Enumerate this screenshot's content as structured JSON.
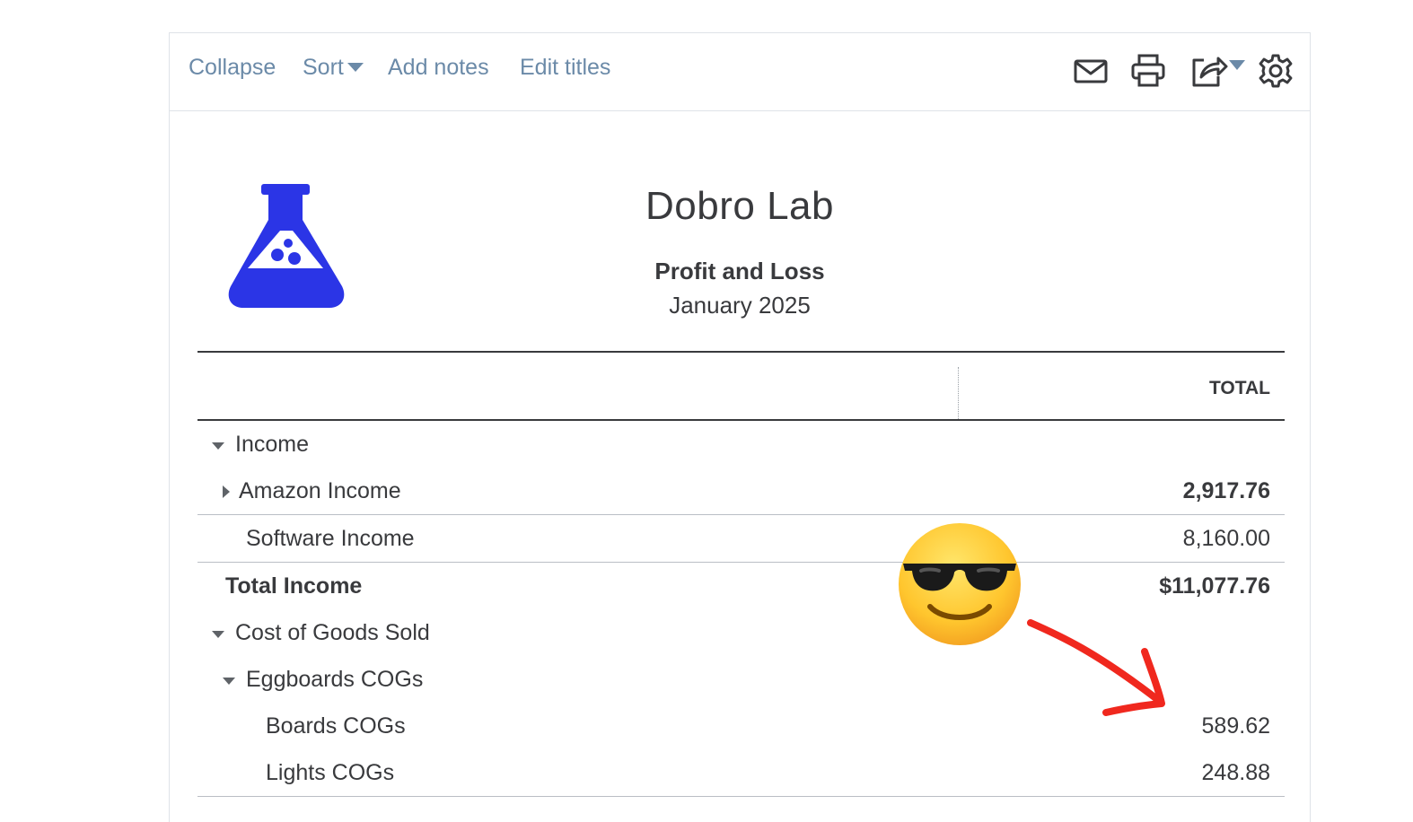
{
  "toolbar": {
    "collapse": "Collapse",
    "sort": "Sort",
    "add_notes": "Add notes",
    "edit_titles": "Edit titles",
    "icons": [
      "mail-icon",
      "print-icon",
      "export-icon",
      "gear-icon"
    ],
    "link_color": "#6b8aa8"
  },
  "header": {
    "company": "Dobro Lab",
    "title": "Profit and Loss",
    "period": "January 2025",
    "logo_color": "#2b35e6"
  },
  "table": {
    "column_header": "TOTAL",
    "rows": [
      {
        "label": "Income",
        "amount": ""
      },
      {
        "label": "Amazon Income",
        "amount": "2,917.76"
      },
      {
        "label": "Software Income",
        "amount": "8,160.00"
      },
      {
        "label": "Total Income",
        "amount": "$11,077.76"
      },
      {
        "label": "Cost of Goods Sold",
        "amount": ""
      },
      {
        "label": "Eggboards COGs",
        "amount": ""
      },
      {
        "label": "Boards COGs",
        "amount": "589.62"
      },
      {
        "label": "Lights COGs",
        "amount": "248.88"
      }
    ]
  },
  "annotations": {
    "emoji": "sunglasses-face",
    "arrow_color": "#f0281e"
  }
}
